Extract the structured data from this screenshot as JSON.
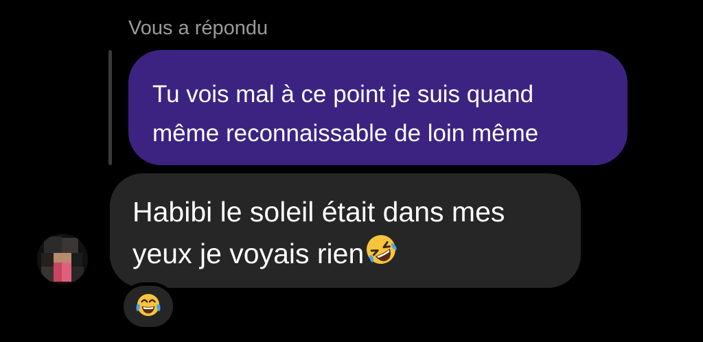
{
  "conversation": {
    "reply_label": "Vous a répondu",
    "sent_message": {
      "lines": [
        "Tu vois mal à ce point je suis quand",
        "même reconnaissable de loin même"
      ]
    },
    "received_message": {
      "lines": [
        "Habibi le soleil était dans mes",
        "yeux je voyais rien"
      ],
      "trailing_emoji": "rolling-on-floor-laughing-emoji"
    },
    "reaction": {
      "emoji": "face-with-tears-of-joy-emoji"
    },
    "avatar": {
      "style": "pixelated"
    }
  },
  "colors": {
    "background": "#000000",
    "sent_bubble": "#3c2382",
    "received_bubble": "#262626",
    "secondary_text": "#9b9b9b",
    "emoji_yellow": "#f7c43c",
    "emoji_blue": "#4aa3ef"
  }
}
